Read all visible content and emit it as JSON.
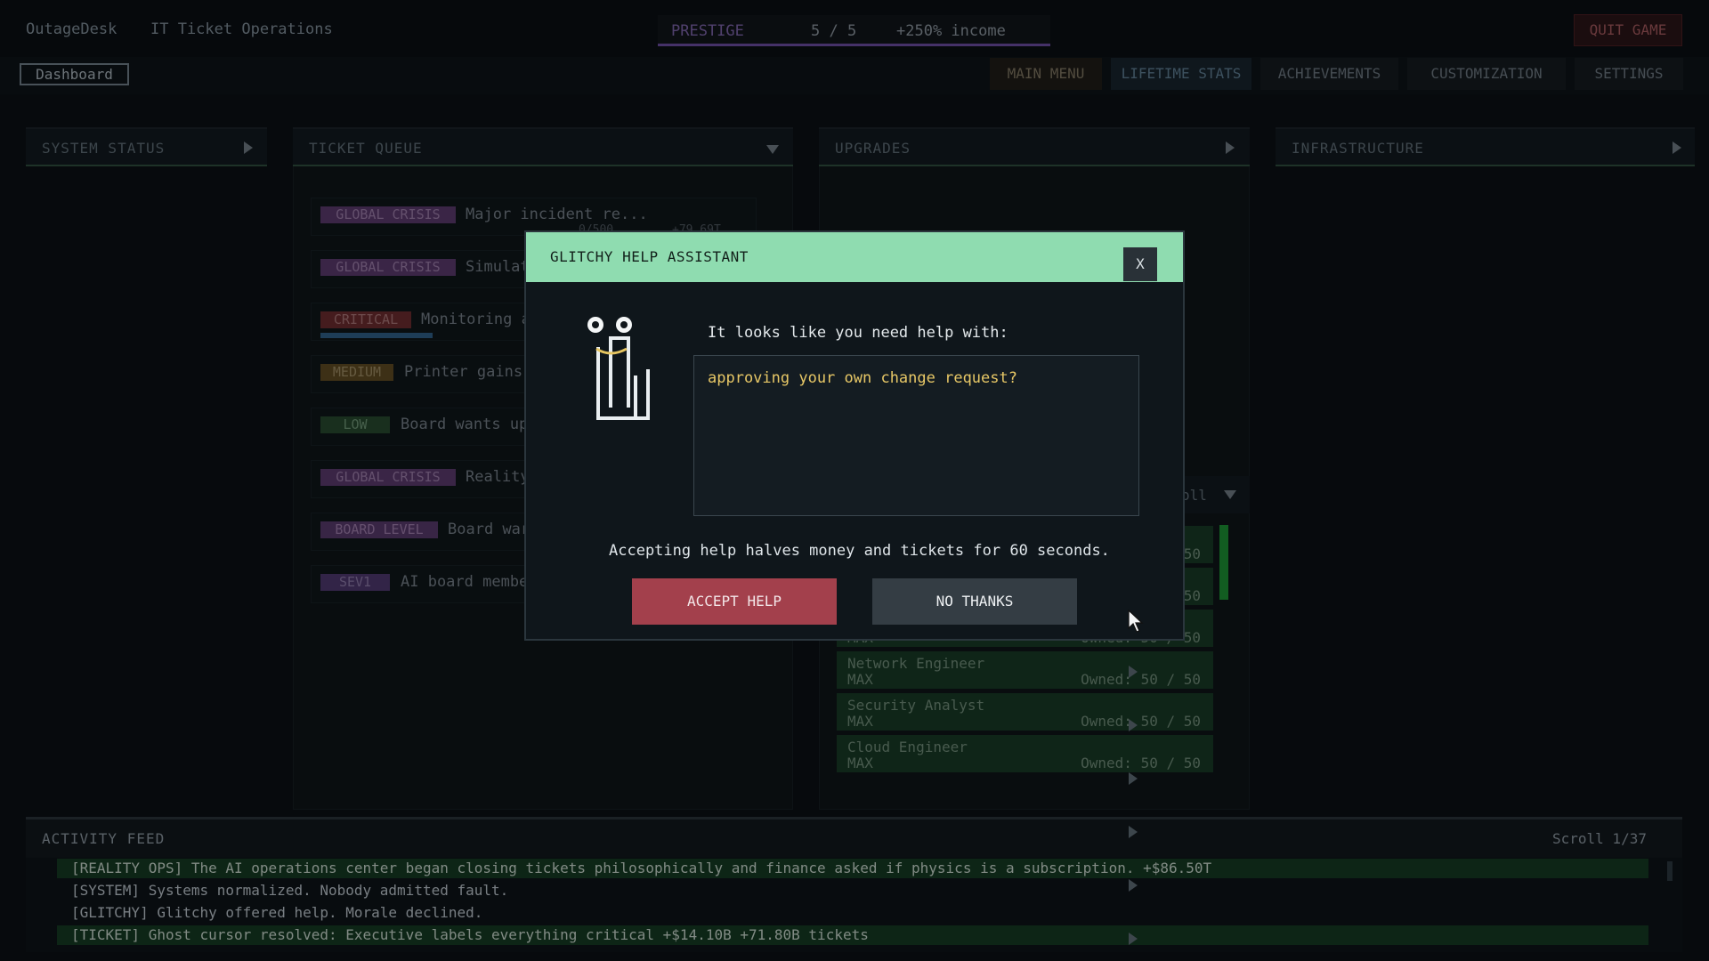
{
  "header": {
    "app_name": "OutageDesk",
    "app_subtitle": "IT Ticket Operations",
    "prestige_label": "PRESTIGE",
    "prestige_count": "5 / 5",
    "prestige_income": "+250% income",
    "quit_label": "QUIT GAME"
  },
  "nav": {
    "dashboard_tab": "Dashboard",
    "main_menu": "MAIN MENU",
    "lifetime_stats": "LIFETIME STATS",
    "achievements": "ACHIEVEMENTS",
    "customization": "CUSTOMIZATION",
    "settings": "SETTINGS"
  },
  "panels": {
    "system_status": "SYSTEM STATUS",
    "ticket_queue": "TICKET QUEUE",
    "upgrades": "UPGRADES",
    "infrastructure": "INFRASTRUCTURE",
    "partial_header_text": "oll"
  },
  "tickets": [
    {
      "severity": "GLOBAL CRISIS",
      "text": "Major incident re...",
      "sub": "0/500",
      "sub2": "+79.69T"
    },
    {
      "severity": "GLOBAL CRISIS",
      "text": "Simulat"
    },
    {
      "severity": "CRITICAL",
      "text": "Monitoring a",
      "progress": 0.2
    },
    {
      "severity": "MEDIUM",
      "text": "Printer gains"
    },
    {
      "severity": "LOW",
      "text": "Board wants up"
    },
    {
      "severity": "GLOBAL CRISIS",
      "text": "Reality"
    },
    {
      "severity": "BOARD LEVEL",
      "text": "Board war"
    },
    {
      "severity": "SEV1",
      "text": "AI board membe"
    }
  ],
  "roles": {
    "partial_values": [
      "50",
      "50",
      "50"
    ],
    "partial_max": "MAX",
    "partial_owned": "Owned: 50 / 50",
    "items": [
      {
        "name": "Network Engineer",
        "status": "MAX",
        "owned": "Owned: 50 / 50"
      },
      {
        "name": "Security Analyst",
        "status": "MAX",
        "owned": "Owned: 50 / 50"
      },
      {
        "name": "Cloud Engineer",
        "status": "MAX",
        "owned": "Owned: 50 / 50"
      }
    ]
  },
  "feed": {
    "title": "ACTIVITY FEED",
    "scroll": "Scroll 1/37",
    "lines": [
      "[REALITY OPS] The AI operations center began closing tickets philosophically and finance asked if physics is a subscription. +$86.50T",
      "[SYSTEM] Systems normalized. Nobody admitted fault.",
      "[GLITCHY] Glitchy offered help. Morale declined.",
      "[TICKET] Ghost cursor resolved: Executive labels everything critical  +$14.10B  +71.80B tickets"
    ]
  },
  "modal": {
    "title": "GLITCHY HELP ASSISTANT",
    "close": "X",
    "prompt": "It looks like you need help with:",
    "help_text": "approving your own change request?",
    "warning": "Accepting help halves money and tickets for 60 seconds.",
    "accept": "ACCEPT HELP",
    "decline": "NO THANKS"
  },
  "colors": {
    "modal_header": "#8fdcb0",
    "accept": "#a3404c",
    "highlight_text": "#e7c766",
    "prestige_accent": "#6a4ca0"
  },
  "icons": [
    "paperclip-mascot-icon",
    "close-icon",
    "triangle-right-icon",
    "triangle-down-icon",
    "mouse-cursor-icon"
  ]
}
